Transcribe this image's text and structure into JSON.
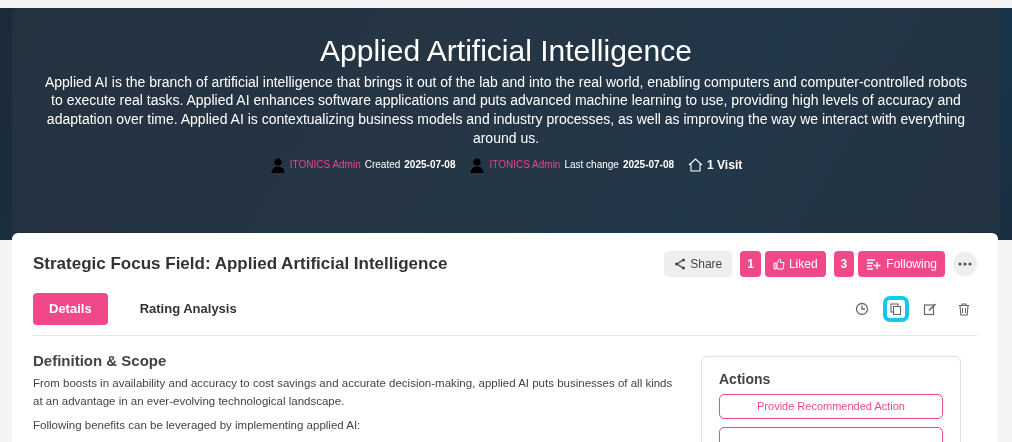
{
  "hero": {
    "title": "Applied Artificial Intelligence",
    "description": "Applied AI is the branch of artificial intelligence that brings it out of the lab and into the real world, enabling computers and computer-controlled robots to execute real tasks. Applied AI enhances software applications and puts advanced machine learning to use, providing high levels of accuracy and adaptation over time. Applied AI is contextualizing business models and industry processes, as well as improving the way we interact with everything around us.",
    "meta": [
      {
        "kind": "user",
        "user": "ITONICS Admin",
        "label": "Created",
        "date": "2025-07-08"
      },
      {
        "kind": "user",
        "user": "ITONICS Admin",
        "label": "Last change",
        "date": "2025-07-08"
      },
      {
        "kind": "visits",
        "label": "1 Visit"
      }
    ]
  },
  "header": {
    "title": "Strategic Focus Field: Applied Artificial Intelligence",
    "share": "Share",
    "likes": {
      "count": "1",
      "label": "Liked"
    },
    "follow": {
      "count": "3",
      "label": "Following"
    }
  },
  "tabs": [
    {
      "label": "Details",
      "selected": true
    },
    {
      "label": "Rating Analysis",
      "selected": false
    }
  ],
  "toolbar": [
    {
      "kind": "history",
      "highlighted": false
    },
    {
      "kind": "copy",
      "highlighted": true
    },
    {
      "kind": "edit",
      "highlighted": false
    },
    {
      "kind": "delete",
      "highlighted": false
    }
  ],
  "definition": {
    "heading": "Definition & Scope",
    "paragraphs": [
      "From boosts in availability and accuracy to cost savings and accurate decision-making, applied AI puts businesses of all kinds at an advantage in an ever-evolving technological landscape.",
      "Following benefits can be leveraged by implementing applied AI:"
    ]
  },
  "actions": {
    "heading": "Actions",
    "buttons": [
      "Provide Recommended Action"
    ]
  }
}
